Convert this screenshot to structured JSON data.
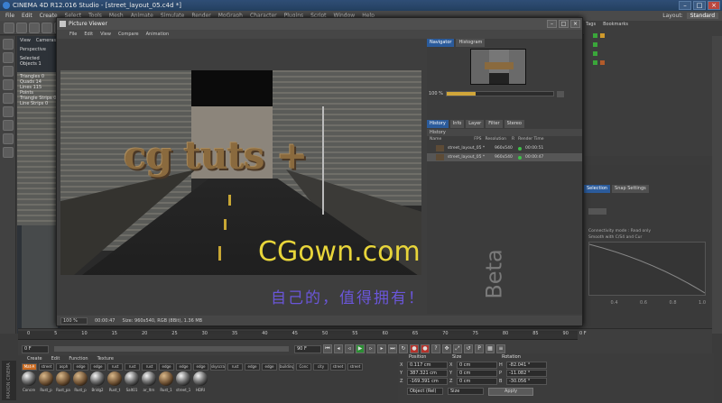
{
  "window": {
    "title": "CINEMA 4D R12.016 Studio - [street_layout_05.c4d *]",
    "layout_label": "Layout:",
    "layout_value": "Standard"
  },
  "menubar": [
    "File",
    "Edit",
    "Create",
    "Select",
    "Tools",
    "Mesh",
    "Animate",
    "Simulate",
    "Render",
    "MoGraph",
    "Character",
    "Plugins",
    "Script",
    "Window",
    "Help"
  ],
  "viewport": {
    "menu": [
      "View",
      "Cameras"
    ],
    "label": "Perspective",
    "stats": [
      {
        "label": "Objects",
        "value": "1"
      },
      {
        "label": "Triangles",
        "value": "0"
      },
      {
        "label": "Quads",
        "value": "14"
      },
      {
        "label": "Lines",
        "value": "115"
      },
      {
        "label": "Points",
        "value": ""
      },
      {
        "label": "Triangle Strips",
        "value": "0"
      },
      {
        "label": "Line Strips",
        "value": "0"
      }
    ],
    "selected": "Selected"
  },
  "picture_viewer": {
    "title": "Picture Viewer",
    "menu": [
      "File",
      "Edit",
      "View",
      "Compare",
      "Animation"
    ],
    "render_text": "cg tuts +",
    "watermark_main": "CGown.com",
    "watermark_sub": "自己的，值得拥有！",
    "watermark_beta": "Beta",
    "status": {
      "zoom": "100 %",
      "time": "00:00:47",
      "info": "Size: 960x540, RGB (8Bit), 1.36 MB"
    }
  },
  "navigator": {
    "tabs": [
      "Navigator",
      "Histogram"
    ],
    "zoom": "100 %",
    "zoom_fraction": 0.27,
    "history_tabs": [
      "History",
      "Info",
      "Layer",
      "Filter",
      "Stereo"
    ],
    "history_label": "History",
    "columns": [
      "Name",
      "FPS",
      "Resolution",
      "R",
      "Render Time"
    ],
    "rows": [
      {
        "name": "street_layout_05 *",
        "resolution": "960x540",
        "time": "00:00:51"
      },
      {
        "name": "street_layout_05 *",
        "resolution": "960x540",
        "time": "00:00:47"
      }
    ]
  },
  "object_manager": {
    "tabs": [
      "Tags",
      "Bookmarks"
    ]
  },
  "attribute_manager": {
    "tabs": [
      "Selection",
      "Snap Settings"
    ],
    "rows": [
      "Connectivity mode : Read only",
      "Smooth with C/S4 and Cur"
    ],
    "graph_ticks": [
      "0.4",
      "0.6",
      "0.8",
      "1.0"
    ]
  },
  "timeline": {
    "frames": [
      "0",
      "5",
      "10",
      "15",
      "20",
      "25",
      "30",
      "35",
      "40",
      "45",
      "50",
      "55",
      "60",
      "65",
      "70",
      "75",
      "80",
      "85",
      "90"
    ],
    "start_field": "0 F",
    "end_field": "90 F",
    "current": "0 F"
  },
  "material_manager": {
    "menu": [
      "Create",
      "Edit",
      "Function",
      "Texture"
    ],
    "labels": [
      "Mat-A",
      "street",
      "asph",
      "edge",
      "edge",
      "rust",
      "rust",
      "rust",
      "edge",
      "edge",
      "edge",
      "skyscra",
      "rust",
      "edge",
      "edge",
      "building",
      "Conc",
      "city",
      "street",
      "street"
    ],
    "names": [
      "Concre",
      "Rust_p",
      "Rust_pa",
      "Rust_p",
      "Bridg2",
      "Rust_t",
      "Salt01",
      "ar_ltrn",
      "Rust_1",
      "street_1",
      "HDRI"
    ],
    "logo": "MAXON CINEMA 4D"
  },
  "coordinates": {
    "headers": [
      "Position",
      "Size",
      "Rotation"
    ],
    "rows": [
      {
        "axis": "X",
        "pos": "0.117 cm",
        "size": "0 cm",
        "rot_axis": "H",
        "rot": "-82.041 °"
      },
      {
        "axis": "Y",
        "pos": "387.321 cm",
        "size": "0 cm",
        "rot_axis": "P",
        "rot": "-11.082 °"
      },
      {
        "axis": "Z",
        "pos": "-169.391 cm",
        "size": "0 cm",
        "rot_axis": "B",
        "rot": "-30.056 °"
      }
    ],
    "mode": "Object (Rel)",
    "size_mode": "Size",
    "apply": "Apply"
  }
}
